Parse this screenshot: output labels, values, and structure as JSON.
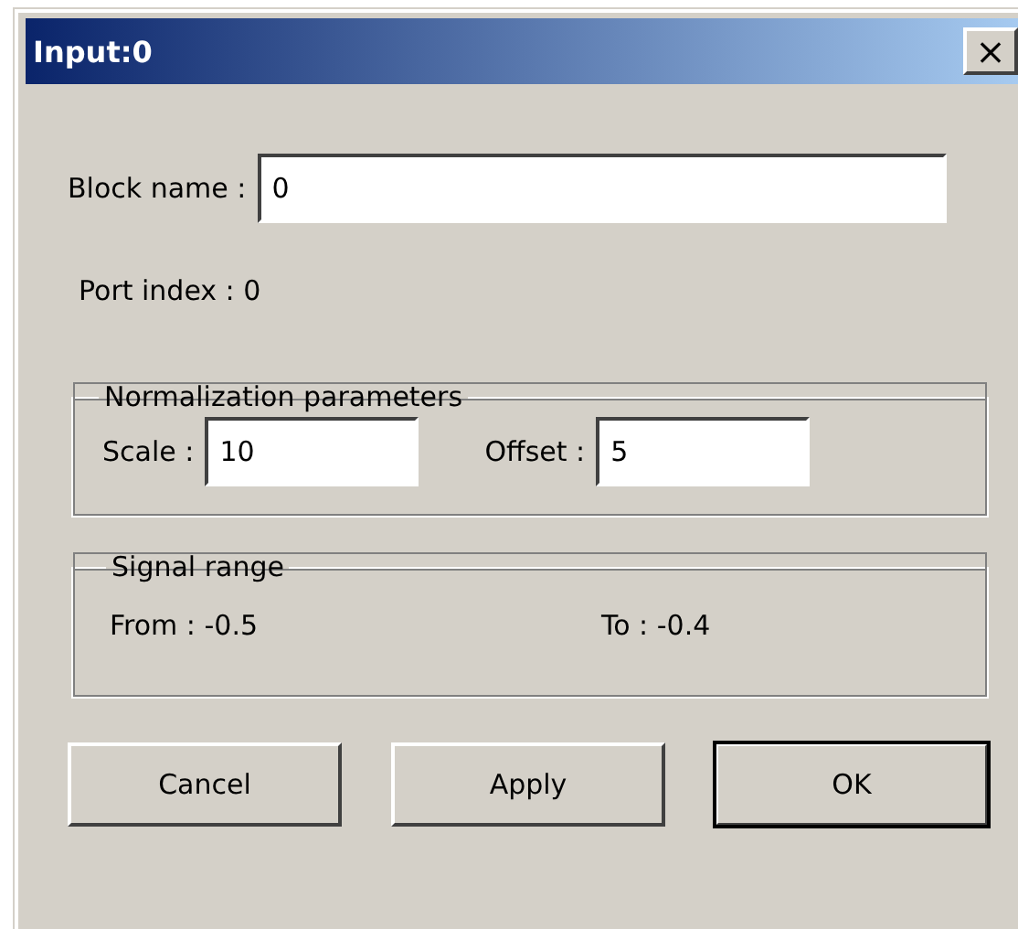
{
  "window": {
    "title": "Input:0",
    "close": "×"
  },
  "block_name": {
    "label": "Block name :",
    "value": "0"
  },
  "port_index": "Port index : 0",
  "normalization": {
    "legend": "Normalization parameters",
    "fields": [
      {
        "label": "Scale :",
        "value": "10"
      },
      {
        "label": "Offset :",
        "value": "5"
      }
    ]
  },
  "signal_range": {
    "legend": "Signal range",
    "from": "From : -0.5",
    "to": "To : -0.4"
  },
  "buttons": [
    {
      "label": "Cancel",
      "default": false
    },
    {
      "label": "Apply",
      "default": false
    },
    {
      "label": "OK",
      "default": true
    }
  ]
}
